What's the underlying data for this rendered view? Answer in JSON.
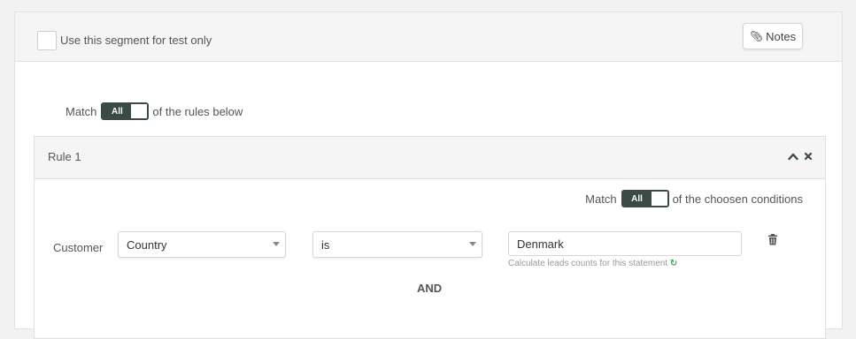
{
  "segment": {
    "test_only_label": "Use this segment for test only",
    "test_only_checked": false
  },
  "notes_button": {
    "label": "Notes",
    "icon": "paperclip-icon"
  },
  "match": {
    "prefix": "Match",
    "toggle_value": "All",
    "suffix": "of the rules below"
  },
  "rule": {
    "title": "Rule 1",
    "icons": [
      "chevron-up-icon",
      "close-icon"
    ],
    "condition_match": {
      "prefix": "Match",
      "toggle_value": "All",
      "suffix": "of the choosen conditions"
    },
    "condition": {
      "entity_label": "Customer",
      "field": "Country",
      "operator": "is",
      "value": "Denmark",
      "calc_link": "Calculate leads counts for this statement"
    },
    "connector": "AND"
  },
  "colors": {
    "toggle_dark": "#3a4a44",
    "refresh_green": "#3aa34a"
  }
}
